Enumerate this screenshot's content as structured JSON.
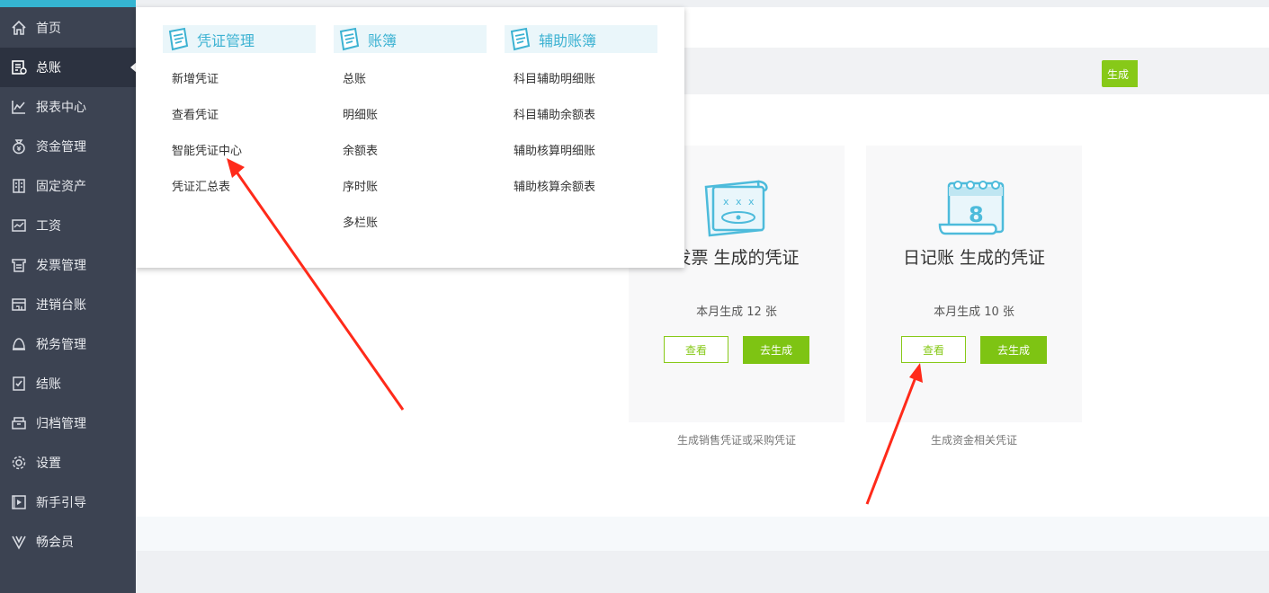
{
  "sidebar": {
    "items": [
      {
        "label": "首页",
        "icon": "home-icon"
      },
      {
        "label": "总账",
        "icon": "ledger-icon",
        "active": true
      },
      {
        "label": "报表中心",
        "icon": "report-chart-icon"
      },
      {
        "label": "资金管理",
        "icon": "money-bag-icon"
      },
      {
        "label": "固定资产",
        "icon": "building-icon"
      },
      {
        "label": "工资",
        "icon": "salary-icon"
      },
      {
        "label": "发票管理",
        "icon": "invoice-icon"
      },
      {
        "label": "进销台账",
        "icon": "inventory-icon"
      },
      {
        "label": "税务管理",
        "icon": "tax-icon"
      },
      {
        "label": "结账",
        "icon": "checkout-icon"
      },
      {
        "label": "归档管理",
        "icon": "archive-icon"
      },
      {
        "label": "设置",
        "icon": "gear-icon"
      },
      {
        "label": "新手引导",
        "icon": "video-guide-icon"
      },
      {
        "label": "畅会员",
        "icon": "vip-icon"
      }
    ]
  },
  "header": {
    "generate_button": "生成"
  },
  "dropdown": {
    "columns": [
      {
        "title": "凭证管理",
        "items": [
          "新增凭证",
          "查看凭证",
          "智能凭证中心",
          "凭证汇总表"
        ]
      },
      {
        "title": "账簿",
        "items": [
          "总账",
          "明细账",
          "余额表",
          "序时账",
          "多栏账"
        ]
      },
      {
        "title": "辅助账簿",
        "items": [
          "科目辅助明细账",
          "科目辅助余额表",
          "辅助核算明细账",
          "辅助核算余额表"
        ]
      }
    ]
  },
  "cards": [
    {
      "title": "发票 生成的凭证",
      "stat": "本月生成 12 张",
      "view_label": "查看",
      "gen_label": "去生成",
      "caption": "生成销售凭证或采购凭证",
      "icon": "invoice-ticket-icon"
    },
    {
      "title": "日记账 生成的凭证",
      "stat": "本月生成 10 张",
      "view_label": "查看",
      "gen_label": "去生成",
      "caption": "生成资金相关凭证",
      "icon": "calendar-journal-icon"
    }
  ],
  "colors": {
    "sidebar_bg": "#3c4352",
    "accent_green": "#7ec413",
    "accent_blue": "#3cb2d2",
    "annotation_red": "#ff2a1a"
  }
}
